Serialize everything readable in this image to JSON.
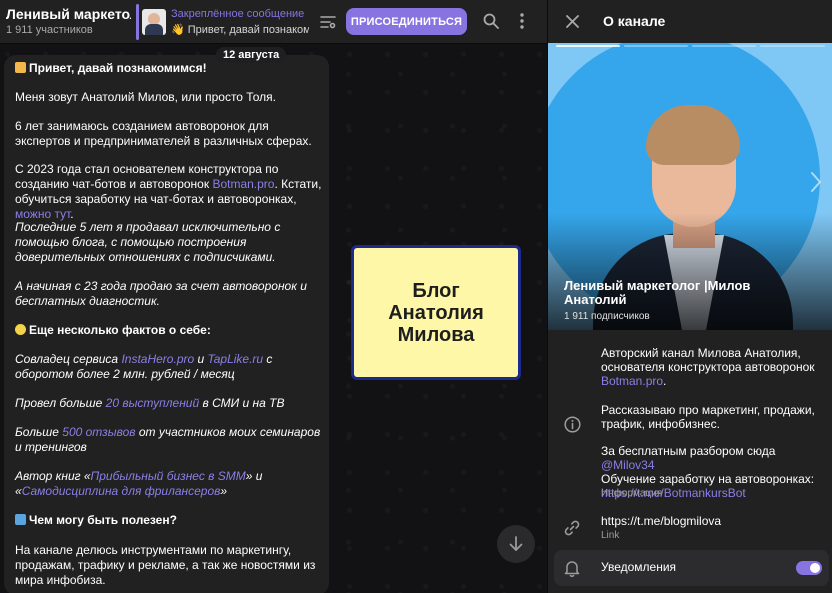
{
  "header": {
    "channel_title": "Ленивый маркетолог",
    "subscribers": "1 911 участников",
    "pinned_label": "Закреплённое сообщение",
    "pinned_text": "👋 Привет, давай познакомимся!",
    "join_label": "ПРИСОЕДИНИТЬСЯ",
    "icons": [
      "filter-icon",
      "search-icon",
      "more-vertical-icon"
    ]
  },
  "chat": {
    "date": "12 августа",
    "message": {
      "greeting": "Привет, давай познакомимся!",
      "p1": "Меня зовут Анатолий Милов, или просто Толя.",
      "p2": "6 лет занимаюсь созданием автоворонок для экспертов и предпринимателей в различных сферах.",
      "p3_a": "С 2023 года стал основателем конструктора по созданию чат-ботов и автоворонок ",
      "p3_link1": "Botman.pro",
      "p3_b": ". Кстати, обучиться заработку на чат-ботах и автоворонках, ",
      "p3_link2": "можно тут",
      "p3_c": ".",
      "p4": "Последние 5 лет я продавал исключительно с помощью блога, с помощью построения доверительных отношениях с подписчиками.",
      "p5": "А начиная с 23 года продаю за счет автоворонок и бесплатных диагностик.",
      "facts_heading": "Еще несколько фактов о себе:",
      "f1_a": "Совладец сервиса ",
      "f1_l1": "InstaHero.pro",
      "f1_b": " и ",
      "f1_l2": "TapLike.ru",
      "f1_c": " с оборотом более 2 млн. рублей / месяц",
      "f2_a": "Провел больше ",
      "f2_l": "20 выступлений",
      "f2_b": " в СМИ и на ТВ",
      "f3_a": "Больше ",
      "f3_l": "500 отзывов",
      "f3_b": " от участников моих семинаров и тренингов",
      "f4_a": "Автор книг «",
      "f4_l1": "Прибыльный бизнес в SMM",
      "f4_b": "» и «",
      "f4_l2": "Самодисциплина для фрилансеров",
      "f4_c": "»",
      "useful_heading": "Чем могу быть полезен?",
      "p_last": "На канале делюсь инструментами по маркетингу, продажам, трафику и рекламе, а так же новостями из мира инфобиза."
    },
    "promo_text": "Блог\nАнатолия\nМилова"
  },
  "panel": {
    "title": "О канале",
    "name": "Ленивый маркетолог |Милов Анатолий",
    "subscribers": "1 911 подписчиков",
    "desc1_a": "Авторский канал Милова Анатолия, основателя конструктора автоворонок ",
    "desc1_link": "Botman.pro",
    "desc1_b": ".",
    "desc2": "Рассказываю про маркетинг, продажи, трафик, инфобизнес.",
    "desc3_a": "За бесплатным разбором сюда ",
    "desc3_link1": "@Milov34",
    "desc3_b": "Обучение заработку на автоворонках: ",
    "desc3_link2": "https://t.me/BotmankursBot",
    "info_caption": "Информация",
    "link": "https://t.me/blogmilova",
    "link_caption": "Link",
    "notifications_label": "Уведомления",
    "notifications_on": true
  },
  "colors": {
    "accent": "#8774e1",
    "link": "#8b7fe8",
    "panel_bg": "#212121",
    "chat_bg": "#121214",
    "promo_bg": "#fff7a8",
    "promo_border": "#1c2a8c",
    "avatar_bg": "#35a6eb"
  }
}
